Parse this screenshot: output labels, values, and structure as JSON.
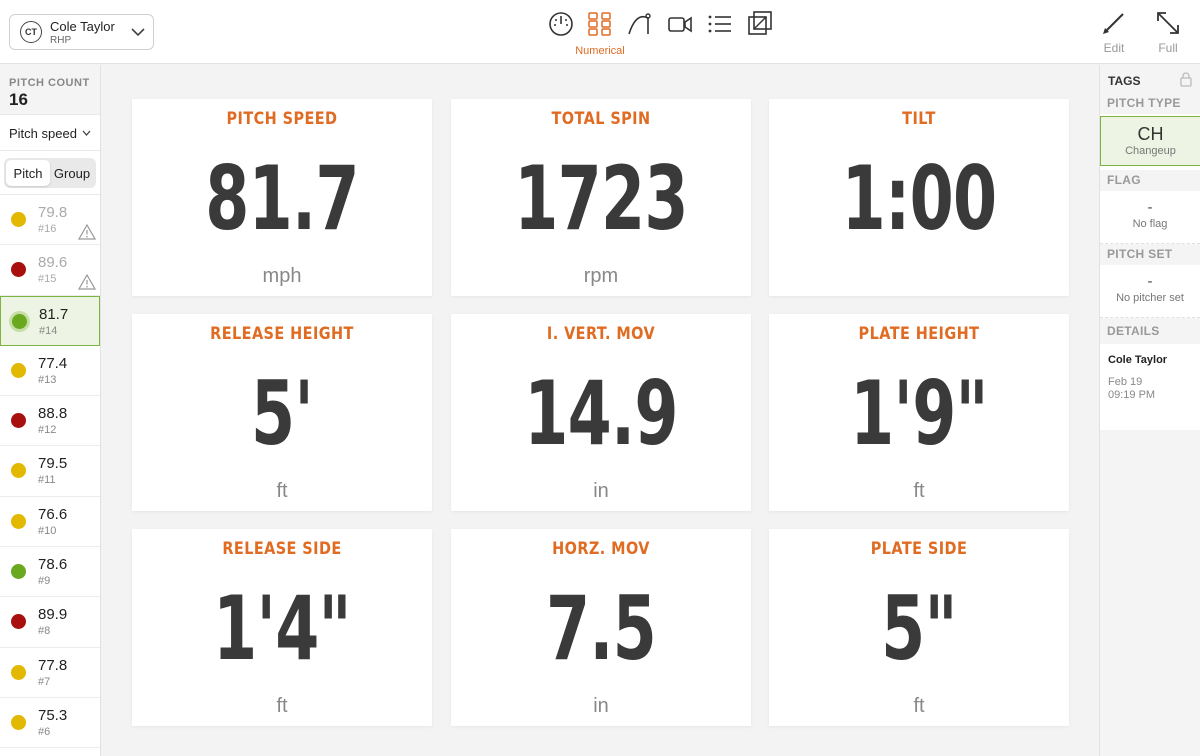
{
  "header": {
    "player": {
      "initials": "CT",
      "name": "Cole Taylor",
      "hand": "RHP"
    },
    "mode_label": "Numerical",
    "modes": [
      "gauge-icon",
      "grid-icon",
      "trajectory-icon",
      "video-icon",
      "list-icon",
      "layers-icon"
    ],
    "edit_label": "Edit",
    "full_label": "Full"
  },
  "sidebar": {
    "pitch_count_label": "PITCH COUNT",
    "pitch_count": "16",
    "metric": "Pitch speed",
    "seg_pitch": "Pitch",
    "seg_group": "Group",
    "pitches": [
      {
        "speed": "79.8",
        "num": "#16",
        "color": "#e3b800",
        "dim": true,
        "warn": true
      },
      {
        "speed": "89.6",
        "num": "#15",
        "color": "#a81010",
        "dim": true,
        "warn": true
      },
      {
        "speed": "81.7",
        "num": "#14",
        "color": "#6aa81f",
        "selected": true
      },
      {
        "speed": "77.4",
        "num": "#13",
        "color": "#e3b800"
      },
      {
        "speed": "88.8",
        "num": "#12",
        "color": "#a81010"
      },
      {
        "speed": "79.5",
        "num": "#11",
        "color": "#e3b800"
      },
      {
        "speed": "76.6",
        "num": "#10",
        "color": "#e3b800"
      },
      {
        "speed": "78.6",
        "num": "#9",
        "color": "#6aa81f"
      },
      {
        "speed": "89.9",
        "num": "#8",
        "color": "#a81010"
      },
      {
        "speed": "77.8",
        "num": "#7",
        "color": "#e3b800"
      },
      {
        "speed": "75.3",
        "num": "#6",
        "color": "#e3b800"
      }
    ]
  },
  "cards": [
    {
      "title": "PITCH SPEED",
      "value": "81.7",
      "unit": "mph"
    },
    {
      "title": "TOTAL SPIN",
      "value": "1723",
      "unit": "rpm"
    },
    {
      "title": "TILT",
      "value": "1:00",
      "unit": ""
    },
    {
      "title": "RELEASE HEIGHT",
      "value": "5'",
      "unit": "ft"
    },
    {
      "title": "I. VERT. MOV",
      "value": "14.9",
      "unit": "in"
    },
    {
      "title": "PLATE HEIGHT",
      "value": "1'9\"",
      "unit": "ft"
    },
    {
      "title": "RELEASE SIDE",
      "value": "1'4\"",
      "unit": "ft"
    },
    {
      "title": "HORZ. MOV",
      "value": "7.5",
      "unit": "in"
    },
    {
      "title": "PLATE SIDE",
      "value": "5\"",
      "unit": "ft"
    }
  ],
  "right": {
    "tags_label": "TAGS",
    "pitch_type_label": "PITCH TYPE",
    "pitch_type_abbr": "CH",
    "pitch_type_full": "Changeup",
    "flag_label": "FLAG",
    "flag_dash": "-",
    "flag_value": "No flag",
    "pitch_set_label": "PITCH SET",
    "pitch_set_dash": "-",
    "pitch_set_value": "No pitcher set",
    "details_label": "DETAILS",
    "details_name": "Cole Taylor",
    "details_date": "Feb 19",
    "details_time": "09:19 PM"
  },
  "colors": {
    "accent": "#e06b22",
    "selected": "#7cb341"
  }
}
